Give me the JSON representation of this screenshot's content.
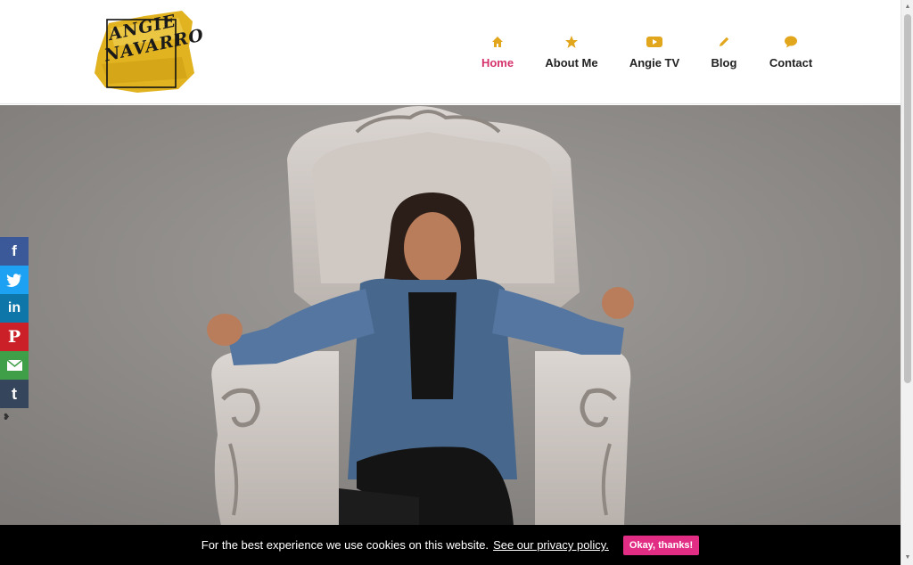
{
  "brand": {
    "logo_text_line1": "ANGIE",
    "logo_text_line2": "NAVARRO",
    "gold": "#e2b321"
  },
  "nav": {
    "accent": "#e2a61d",
    "active_color": "#d6336c",
    "items": [
      {
        "label": "Home",
        "icon": "home-icon",
        "active": true
      },
      {
        "label": "About Me",
        "icon": "star-icon",
        "active": false
      },
      {
        "label": "Angie TV",
        "icon": "youtube-icon",
        "active": false
      },
      {
        "label": "Blog",
        "icon": "pencil-icon",
        "active": false
      },
      {
        "label": "Contact",
        "icon": "speech-bubble-icon",
        "active": false
      }
    ]
  },
  "share": {
    "items": [
      {
        "label": "f",
        "icon": "facebook-icon",
        "color": "#3b5998"
      },
      {
        "label": "",
        "icon": "twitter-icon",
        "color": "#1da1f2"
      },
      {
        "label": "in",
        "icon": "linkedin-icon",
        "color": "#0e76a8"
      },
      {
        "label": "P",
        "icon": "pinterest-icon",
        "color": "#cb2027"
      },
      {
        "label": "",
        "icon": "email-icon",
        "color": "#3f9f49"
      },
      {
        "label": "t",
        "icon": "tumblr-icon",
        "color": "#35465c"
      }
    ],
    "hide_symbol": "❥"
  },
  "cookie": {
    "message": "For the best experience we use cookies on this website.",
    "link": "See our privacy policy.",
    "button": "Okay, thanks!",
    "button_color": "#e22d84"
  }
}
